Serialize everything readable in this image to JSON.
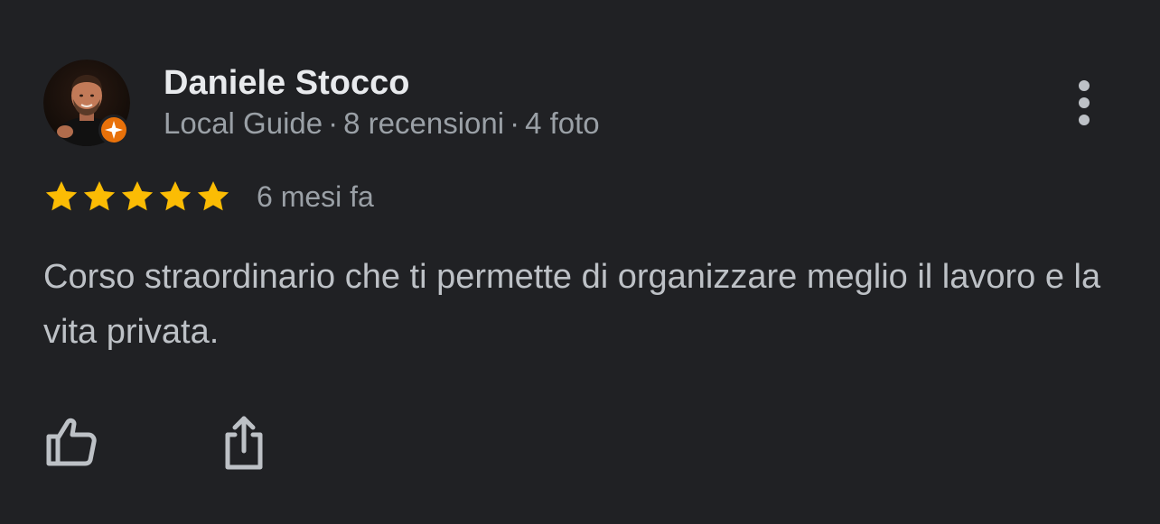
{
  "review": {
    "author": {
      "name": "Daniele Stocco",
      "level": "Local Guide",
      "reviews_count": "8 recensioni",
      "photos_count": "4 foto",
      "separator": "·",
      "avatar_icon": "user-avatar-photo",
      "badge_icon": "local-guide-star-badge",
      "badge_color": "#e8710a"
    },
    "rating": {
      "stars": 5,
      "max_stars": 5,
      "star_color": "#fbbc04",
      "date": "6 mesi fa"
    },
    "text": "Corso straordinario che ti permette di organizzare meglio il lavoro e la vita privata.",
    "actions": {
      "like_icon": "thumbs-up-icon",
      "share_icon": "share-icon",
      "more_icon": "more-vert-icon"
    }
  },
  "theme": {
    "background": "#202124",
    "primary_text": "#e8eaed",
    "secondary_text": "#9aa0a6",
    "body_text": "#bdc1c6",
    "icon_color": "#bdc1c6"
  }
}
